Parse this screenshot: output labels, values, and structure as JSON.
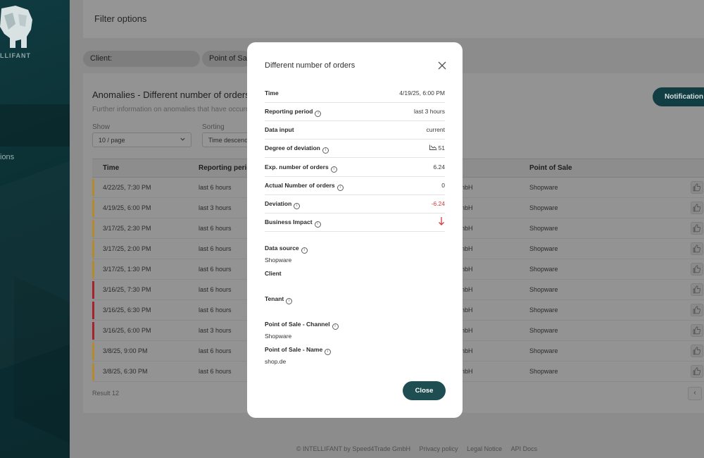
{
  "sidebar": {
    "logo_text": "LLIFANT",
    "nav_item_partial": "ions"
  },
  "filter": {
    "title": "Filter options",
    "client_chip": "Client:",
    "pos_chip": "Point of Sale"
  },
  "main": {
    "title": "Anomalies - Different number of orders",
    "subtitle": "Further information on anomalies that have occurred",
    "notification_button": "Notification",
    "show_label": "Show",
    "show_value": "10 / page",
    "sorting_label": "Sorting",
    "sorting_value": "Time descending",
    "table": {
      "headers": {
        "time": "Time",
        "reporting": "Reporting period",
        "pos": "Point of Sale"
      },
      "rows": [
        {
          "time": "4/22/25, 7:30 PM",
          "period": "last 6 hours",
          "client": "nbH",
          "pos": "Shopware",
          "severity_color": "#b58a2c"
        },
        {
          "time": "4/19/25, 6:00 PM",
          "period": "last 3 hours",
          "client": "nbH",
          "pos": "Shopware",
          "severity_color": "#b58a2c"
        },
        {
          "time": "3/17/25, 2:30 PM",
          "period": "last 6 hours",
          "client": "nbH",
          "pos": "Shopware",
          "severity_color": "#b58a2c"
        },
        {
          "time": "3/17/25, 2:00 PM",
          "period": "last 6 hours",
          "client": "nbH",
          "pos": "Shopware",
          "severity_color": "#b58a2c"
        },
        {
          "time": "3/17/25, 1:30 PM",
          "period": "last 6 hours",
          "client": "nbH",
          "pos": "Shopware",
          "severity_color": "#b58a2c"
        },
        {
          "time": "3/16/25, 7:30 PM",
          "period": "last 6 hours",
          "client": "nbH",
          "pos": "Shopware",
          "severity_color": "#a3232e"
        },
        {
          "time": "3/16/25, 6:30 PM",
          "period": "last 6 hours",
          "client": "nbH",
          "pos": "Shopware",
          "severity_color": "#a3232e"
        },
        {
          "time": "3/16/25, 6:00 PM",
          "period": "last 3 hours",
          "client": "nbH",
          "pos": "Shopware",
          "severity_color": "#a3232e"
        },
        {
          "time": "3/8/25, 9:00 PM",
          "period": "last 6 hours",
          "client": "nbH",
          "pos": "Shopware",
          "severity_color": "#b58a2c"
        },
        {
          "time": "3/8/25, 6:30 PM",
          "period": "last 6 hours",
          "client": "nbH",
          "pos": "Shopware",
          "severity_color": "#b58a2c"
        }
      ]
    },
    "result": "Result 12",
    "pager_prev": "‹"
  },
  "footer": {
    "copyright": "© INTELLIFANT by Speed4Trade GmbH",
    "privacy": "Privacy policy",
    "legal": "Legal Notice",
    "api": "API Docs"
  },
  "modal": {
    "title": "Different number of orders",
    "fields": {
      "time": {
        "label": "Time",
        "value": "4/19/25, 6:00 PM"
      },
      "reporting_period": {
        "label": "Reporting period",
        "value": "last 3 hours"
      },
      "data_input": {
        "label": "Data input",
        "value": "current"
      },
      "degree_of_deviation": {
        "label": "Degree of deviation",
        "value": "51"
      },
      "exp_orders": {
        "label": "Exp. number of orders",
        "value": "6.24"
      },
      "actual_orders": {
        "label": "Actual Number of orders",
        "value": "0"
      },
      "deviation": {
        "label": "Deviation",
        "value": "-6.24"
      },
      "business_impact": {
        "label": "Business Impact",
        "icon": "arrow-down-icon"
      }
    },
    "data_source": {
      "label": "Data source",
      "value": "Shopware"
    },
    "client": {
      "label": "Client",
      "value": ""
    },
    "tenant": {
      "label": "Tenant",
      "value": ""
    },
    "pos_channel": {
      "label": "Point of Sale - Channel",
      "value": "Shopware"
    },
    "pos_name": {
      "label": "Point of Sale - Name",
      "value": "shop.de"
    },
    "close_button": "Close",
    "info_glyph": "i",
    "colors": {
      "negative": "#d23b3b",
      "primary": "#1e4d52"
    }
  }
}
